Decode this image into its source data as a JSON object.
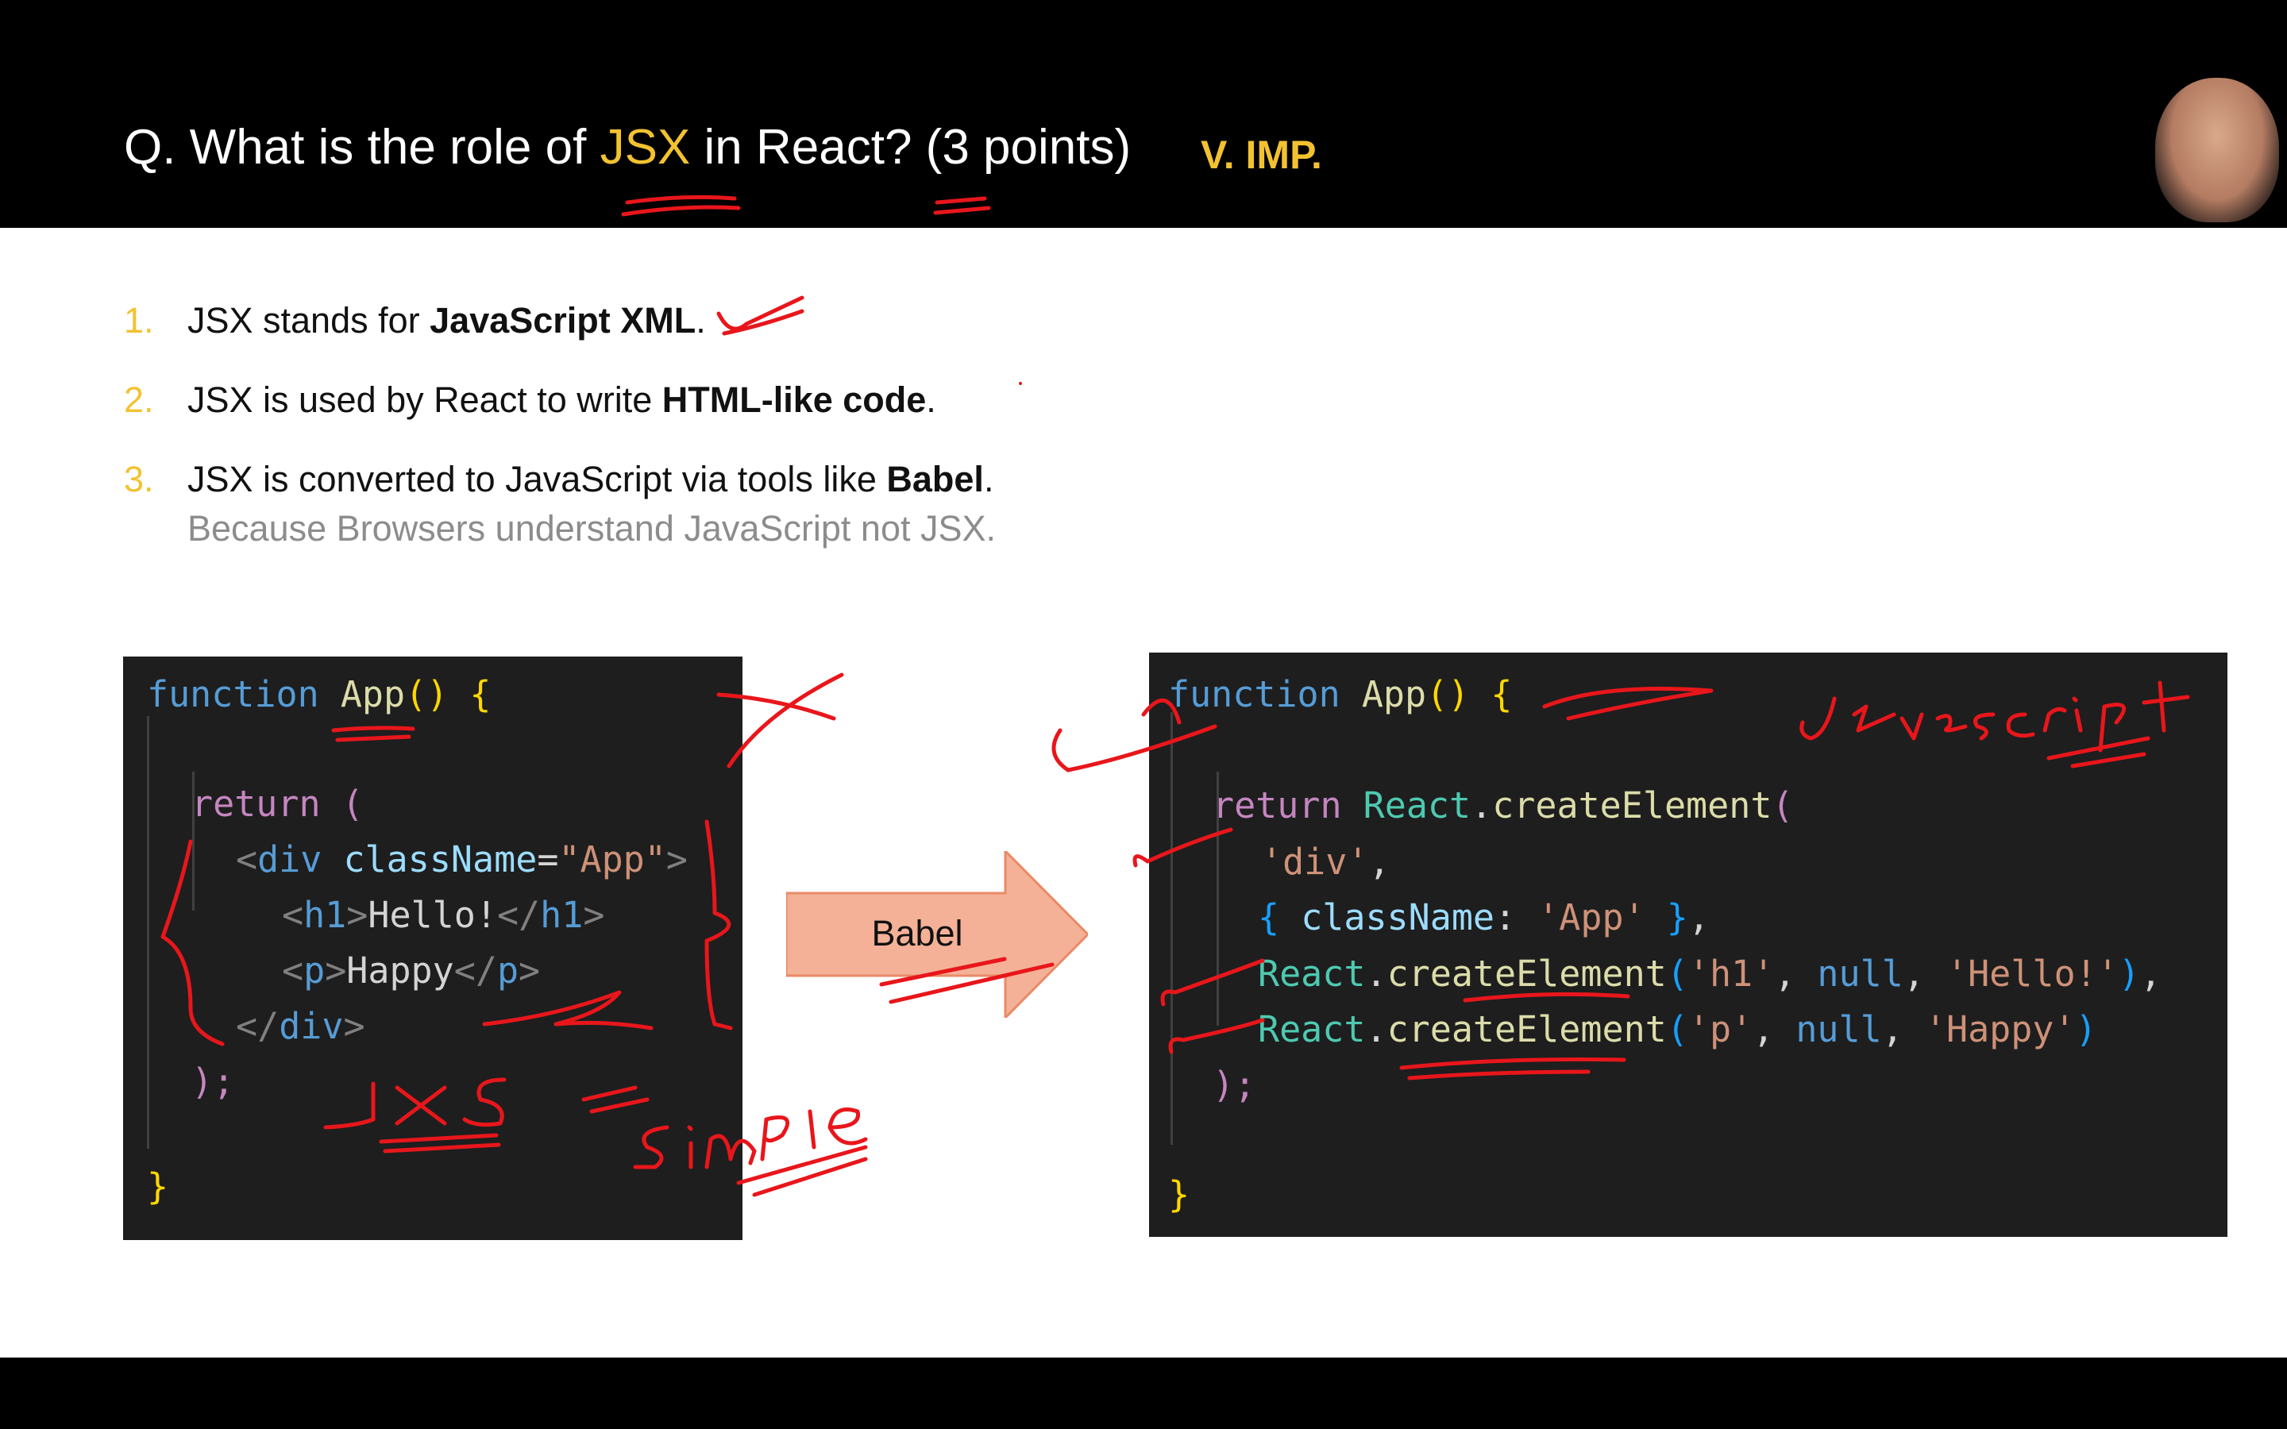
{
  "header": {
    "title_prefix": "Q. What is the role of ",
    "title_accent": "JSX",
    "title_suffix": " in React? (3 points)",
    "importance": "V. IMP."
  },
  "points": [
    {
      "num": "1.",
      "pre": "JSX stands for ",
      "bold": "JavaScript XML",
      "post": "."
    },
    {
      "num": "2.",
      "pre": "JSX is used by React to write ",
      "bold": "HTML-like code",
      "post": "."
    },
    {
      "num": "3.",
      "pre": "JSX is converted to JavaScript via tools like ",
      "bold": "Babel",
      "post": "."
    }
  ],
  "subnote": "Because Browsers understand JavaScript not JSX.",
  "jsx_code": {
    "l1_kw": "function",
    "l1_fn": "App",
    "l1_paren": "()",
    "l1_brace": "{",
    "l3_kw": "return",
    "l3_paren": "(",
    "l4_tag": "div",
    "l4_attr": "className",
    "l4_val": "\"App\"",
    "l5_tag": "h1",
    "l5_text": "Hello!",
    "l6_tag": "p",
    "l6_text": "Happy",
    "l7_tag": "div",
    "l8": ");",
    "l10": "}"
  },
  "js_code": {
    "l1_kw": "function",
    "l1_fn": "App",
    "l1_paren": "()",
    "l1_brace": "{",
    "l3_kw": "return",
    "l3_obj": "React",
    "l3_fn": "createElement",
    "l3_paren": "(",
    "l4_str": "'div'",
    "l5_prop": "className",
    "l5_val": "'App'",
    "l6_obj": "React",
    "l6_fn": "createElement",
    "l6_a": "'h1'",
    "l6_null": "null",
    "l6_b": "'Hello!'",
    "l7_obj": "React",
    "l7_fn": "createElement",
    "l7_a": "'p'",
    "l7_null": "null",
    "l7_b": "'Happy'",
    "l8": ");",
    "l10": "}"
  },
  "arrow_label": "Babel",
  "colors": {
    "accent": "#f2c230",
    "annotation": "#e8161b",
    "arrow_fill": "#f4b197",
    "editor_bg": "#1e1e1e"
  }
}
